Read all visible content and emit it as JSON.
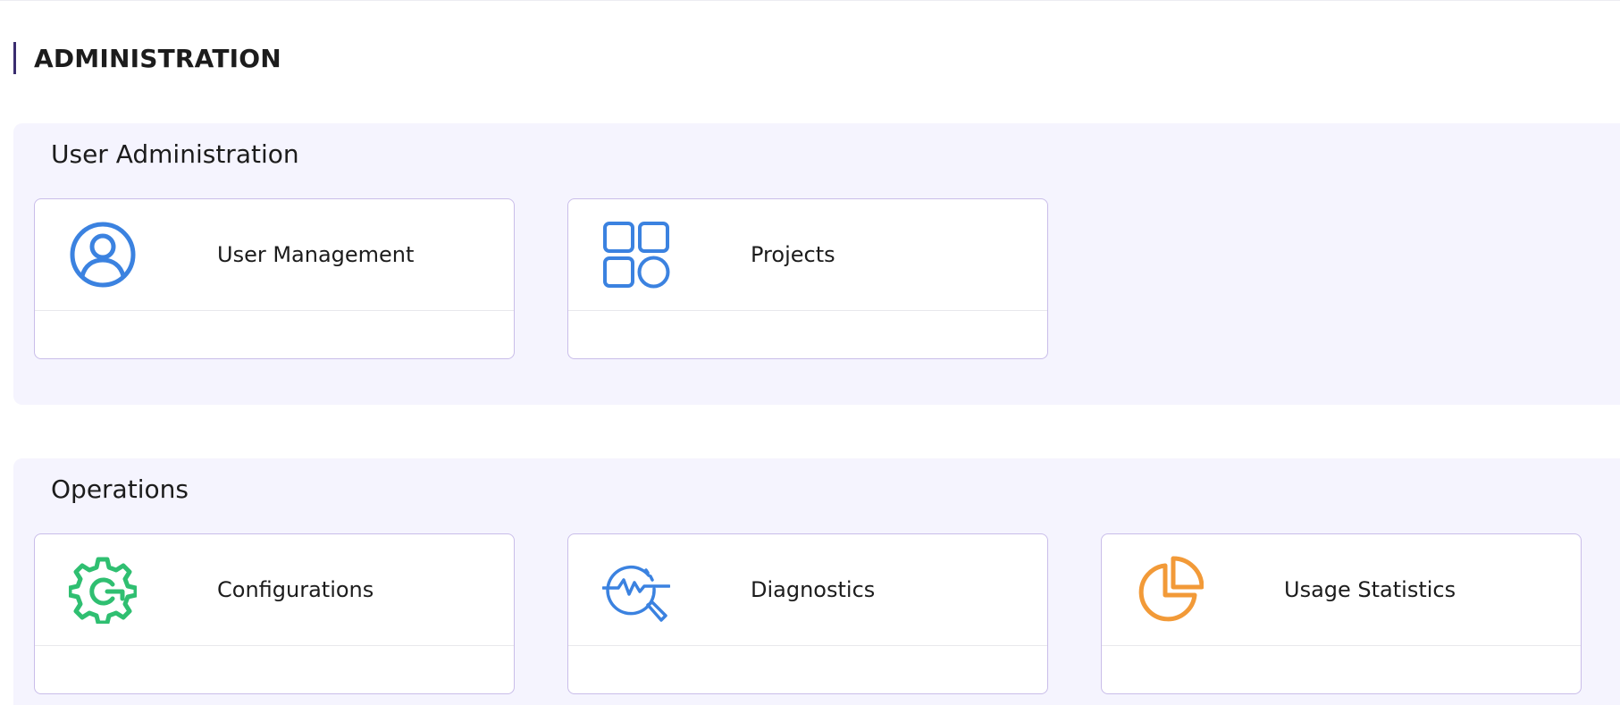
{
  "page": {
    "title": "ADMINISTRATION"
  },
  "sections": [
    {
      "title": "User Administration",
      "cards": [
        {
          "label": "User Management",
          "icon": "user-icon",
          "color": "#3b82e0"
        },
        {
          "label": "Projects",
          "icon": "grid-apps-icon",
          "color": "#3b82e0"
        }
      ]
    },
    {
      "title": "Operations",
      "cards": [
        {
          "label": "Configurations",
          "icon": "gear-icon",
          "color": "#2fbf71"
        },
        {
          "label": "Diagnostics",
          "icon": "diagnostics-search-icon",
          "color": "#3b82e0"
        },
        {
          "label": "Usage Statistics",
          "icon": "pie-chart-icon",
          "color": "#f29a38"
        }
      ]
    }
  ],
  "colors": {
    "accent_bar": "#3a2d6f",
    "section_bg": "#f5f4fe",
    "card_border": "#c9bde9"
  }
}
